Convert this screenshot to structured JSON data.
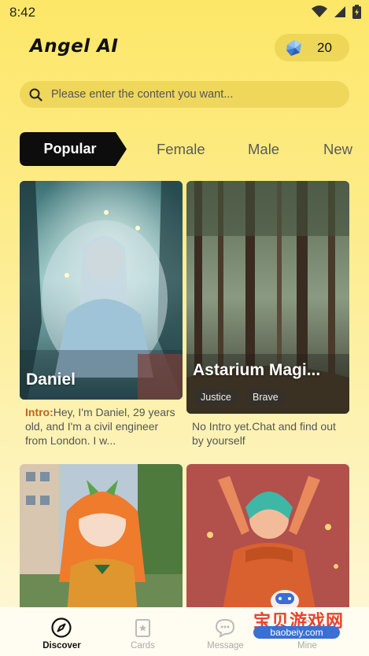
{
  "status_bar": {
    "time": "8:42",
    "icons": [
      "wifi-icon",
      "signal-icon",
      "battery-icon"
    ]
  },
  "header": {
    "title": "Angel AI",
    "gem_icon": "gem-icon",
    "gem_count": "20"
  },
  "search": {
    "placeholder": "Please enter the content you want..."
  },
  "tabs": [
    {
      "label": "Popular",
      "active": true
    },
    {
      "label": "Female",
      "active": false
    },
    {
      "label": "Male",
      "active": false
    },
    {
      "label": "New",
      "active": false
    }
  ],
  "cards": [
    {
      "name": "Daniel",
      "intro_label": "Intro:",
      "intro_text": "Hey, I'm Daniel, 29 years old, and I'm a civil engineer from London. I w...",
      "tags": []
    },
    {
      "name": "Astarium Magi...",
      "intro_label": "",
      "intro_text": "No Intro yet.Chat and find out by yourself",
      "tags": [
        "Justice",
        "Brave"
      ]
    },
    {
      "name": "",
      "intro_text": "",
      "tags": []
    },
    {
      "name": "",
      "intro_text": "",
      "tags": []
    }
  ],
  "bottom_nav": [
    {
      "label": "Discover",
      "icon": "compass-icon",
      "active": true
    },
    {
      "label": "Cards",
      "icon": "cards-icon",
      "active": false
    },
    {
      "label": "Message",
      "icon": "message-icon",
      "active": false
    },
    {
      "label": "Mine",
      "icon": "profile-icon",
      "active": false
    }
  ],
  "watermark": {
    "text": "宝贝游戏网",
    "url": "baobeiy.com"
  },
  "colors": {
    "background_top": "#fde768",
    "background_bottom": "#fef8dc",
    "tab_active_bg": "#0d0d0d",
    "intro_label": "#c1621f"
  }
}
